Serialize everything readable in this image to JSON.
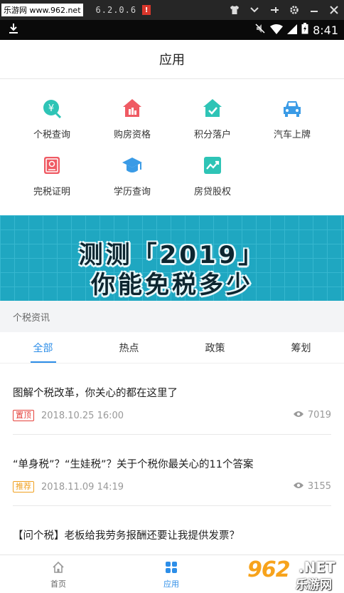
{
  "emulator": {
    "watermark": "乐游网 www.962.net",
    "version": "6.2.0.6",
    "alert": "!"
  },
  "status_bar": {
    "time": "8:41"
  },
  "header": {
    "title": "应用"
  },
  "apps": [
    {
      "label": "个税查询",
      "icon": "yuan-search-icon",
      "color": "#2ec4b6"
    },
    {
      "label": "购房资格",
      "icon": "house-icon",
      "color": "#ef5a63"
    },
    {
      "label": "积分落户",
      "icon": "home-check-icon",
      "color": "#2ec4b6"
    },
    {
      "label": "汽车上牌",
      "icon": "car-icon",
      "color": "#3a9be6"
    },
    {
      "label": "完税证明",
      "icon": "certificate-icon",
      "color": "#ef5a63"
    },
    {
      "label": "学历查询",
      "icon": "graduation-cap-icon",
      "color": "#3a9be6"
    },
    {
      "label": "房贷股权",
      "icon": "trend-chart-icon",
      "color": "#2ec4b6"
    }
  ],
  "banner": {
    "line1": "测测「2019」",
    "line2": "你能免税多少"
  },
  "section": {
    "title": "个税资讯"
  },
  "tabs": [
    "全部",
    "热点",
    "政策",
    "筹划"
  ],
  "news": [
    {
      "title": "图解个税改革，你关心的都在这里了",
      "tag": "置顶",
      "time": "2018.10.25 16:00",
      "views": "7019"
    },
    {
      "title": "“单身税”？“生娃税”？关于个税你最关心的11个答案",
      "tag": "推荐",
      "time": "2018.11.09 14:19",
      "views": "3155"
    },
    {
      "title": "【问个税】老板给我劳务报酬还要让我提供发票？",
      "tag": "",
      "time": "",
      "views": ""
    }
  ],
  "bottom_nav": [
    {
      "label": "首页",
      "icon": "home-icon",
      "active": false
    },
    {
      "label": "应用",
      "icon": "apps-grid-icon",
      "active": true
    }
  ],
  "watermark_br": {
    "big": "962",
    "net": ".NET",
    "sub": "乐游网"
  },
  "colors": {
    "accent": "#2d8ee8",
    "banner": "#1fa7c1"
  }
}
